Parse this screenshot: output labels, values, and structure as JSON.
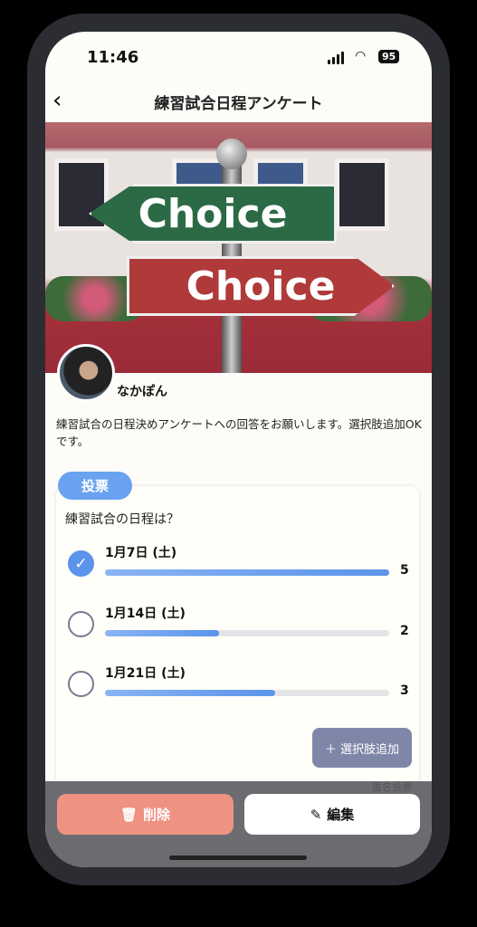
{
  "status": {
    "time": "11:46",
    "battery": "95"
  },
  "header": {
    "back_icon": "chevron-left-icon",
    "title": "練習試合日程アンケート"
  },
  "banner": {
    "sign_top": "Choice",
    "sign_bottom": "Choice"
  },
  "author": {
    "name": "なかぽん"
  },
  "description": "練習試合の日程決めアンケートへの回答をお願いします。選択肢追加OKです。",
  "poll": {
    "badge": "投票",
    "question": "練習試合の日程は？",
    "options": [
      {
        "label": "1月7日 (土)",
        "votes": "5",
        "selected": true,
        "fill_percent": 100
      },
      {
        "label": "1月14日 (土)",
        "votes": "2",
        "selected": false,
        "fill_percent": 40
      },
      {
        "label": "1月21日 (土)",
        "votes": "3",
        "selected": false,
        "fill_percent": 60
      }
    ],
    "add_option": "＋ 選択肢追加",
    "anonymous": "匿名投票"
  },
  "actions": {
    "delete": "削除",
    "edit": "編集"
  },
  "colors": {
    "accent": "#5b94ea",
    "delete": "#ee9282",
    "add": "#7f87a8"
  }
}
